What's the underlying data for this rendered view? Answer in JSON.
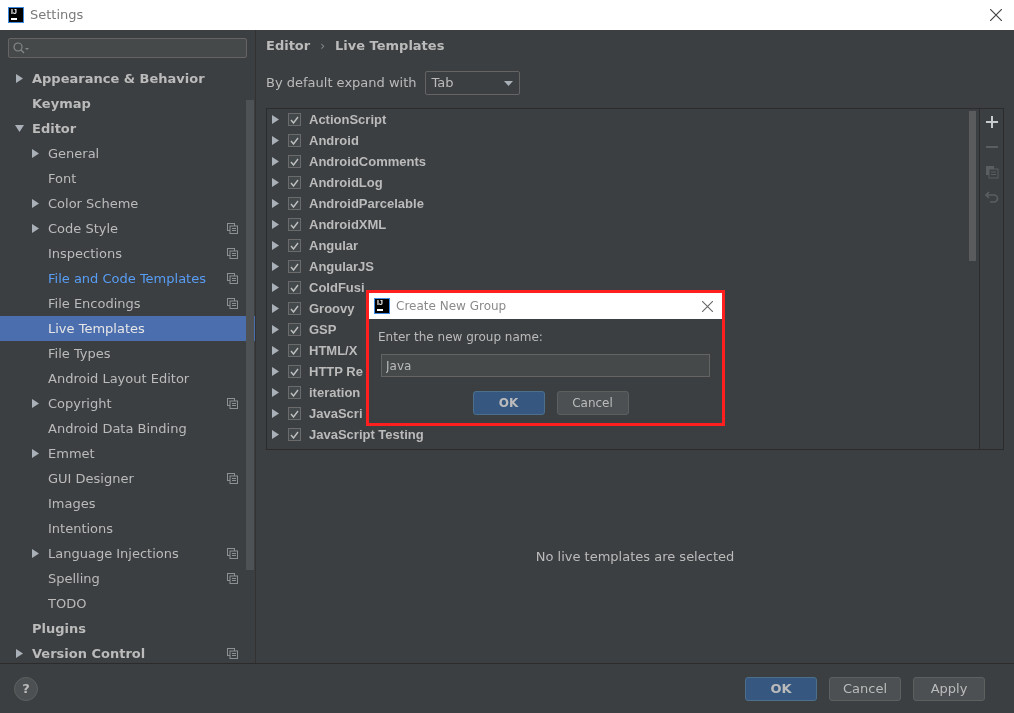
{
  "window": {
    "title": "Settings",
    "logo": "IJ"
  },
  "sidebar": {
    "items": [
      {
        "label": "Appearance & Behavior",
        "expanded": false,
        "selected": false
      },
      {
        "label": "Keymap",
        "selected": false
      },
      {
        "label": "Editor",
        "expanded": true,
        "selected": false,
        "children": [
          {
            "label": "General",
            "expanded": false,
            "selected": false
          },
          {
            "label": "Font",
            "selected": false
          },
          {
            "label": "Color Scheme",
            "expanded": false,
            "selected": false
          },
          {
            "label": "Code Style",
            "expanded": false,
            "selected": false,
            "project_icon": true
          },
          {
            "label": "Inspections",
            "selected": false,
            "project_icon": true
          },
          {
            "label": "File and Code Templates",
            "selected": false,
            "modified": true,
            "project_icon": true
          },
          {
            "label": "File Encodings",
            "selected": false,
            "project_icon": true
          },
          {
            "label": "Live Templates",
            "selected": true
          },
          {
            "label": "File Types",
            "selected": false
          },
          {
            "label": "Android Layout Editor",
            "selected": false
          },
          {
            "label": "Copyright",
            "expanded": false,
            "selected": false,
            "project_icon": true
          },
          {
            "label": "Android Data Binding",
            "selected": false
          },
          {
            "label": "Emmet",
            "expanded": false,
            "selected": false
          },
          {
            "label": "GUI Designer",
            "selected": false,
            "project_icon": true
          },
          {
            "label": "Images",
            "selected": false
          },
          {
            "label": "Intentions",
            "selected": false
          },
          {
            "label": "Language Injections",
            "expanded": false,
            "selected": false,
            "project_icon": true
          },
          {
            "label": "Spelling",
            "selected": false,
            "project_icon": true
          },
          {
            "label": "TODO",
            "selected": false
          }
        ]
      },
      {
        "label": "Plugins",
        "selected": false
      },
      {
        "label": "Version Control",
        "expanded": false,
        "selected": false,
        "project_icon": true
      }
    ]
  },
  "breadcrumb": [
    "Editor",
    "Live Templates"
  ],
  "breadcrumb_separator": "›",
  "expand_with": {
    "label": "By default expand with",
    "value": "Tab"
  },
  "template_groups": [
    {
      "name": "ActionScript",
      "checked": true,
      "expanded": false
    },
    {
      "name": "Android",
      "checked": true,
      "expanded": false
    },
    {
      "name": "AndroidComments",
      "checked": true,
      "expanded": false
    },
    {
      "name": "AndroidLog",
      "checked": true,
      "expanded": false
    },
    {
      "name": "AndroidParcelable",
      "checked": true,
      "expanded": false
    },
    {
      "name": "AndroidXML",
      "checked": true,
      "expanded": false
    },
    {
      "name": "Angular",
      "checked": true,
      "expanded": false
    },
    {
      "name": "AngularJS",
      "checked": true,
      "expanded": false
    },
    {
      "name": "ColdFusi",
      "checked": true,
      "expanded": false
    },
    {
      "name": "Groovy",
      "checked": true,
      "expanded": false
    },
    {
      "name": "GSP",
      "checked": true,
      "expanded": false
    },
    {
      "name": "HTML/X",
      "checked": true,
      "expanded": false
    },
    {
      "name": "HTTP Re",
      "checked": true,
      "expanded": false
    },
    {
      "name": "iteration",
      "checked": true,
      "expanded": false
    },
    {
      "name": "JavaScri",
      "checked": true,
      "expanded": false
    },
    {
      "name": "JavaScript Testing",
      "checked": true,
      "expanded": false
    }
  ],
  "toolbar": [
    {
      "kind": "add",
      "disabled": false
    },
    {
      "kind": "remove",
      "disabled": true
    },
    {
      "kind": "copy",
      "disabled": true
    },
    {
      "kind": "restore",
      "disabled": true
    }
  ],
  "empty_message": "No live templates are selected",
  "dialog": {
    "logo": "IJ",
    "title": "Create New Group",
    "prompt": "Enter the new group name:",
    "value": "Java",
    "buttons": [
      {
        "label": "OK",
        "default": true
      },
      {
        "label": "Cancel",
        "default": false
      }
    ]
  },
  "help_button": "?",
  "footer_buttons": [
    {
      "label": "OK",
      "default": true
    },
    {
      "label": "Cancel",
      "default": false
    },
    {
      "label": "Apply",
      "default": false
    }
  ]
}
